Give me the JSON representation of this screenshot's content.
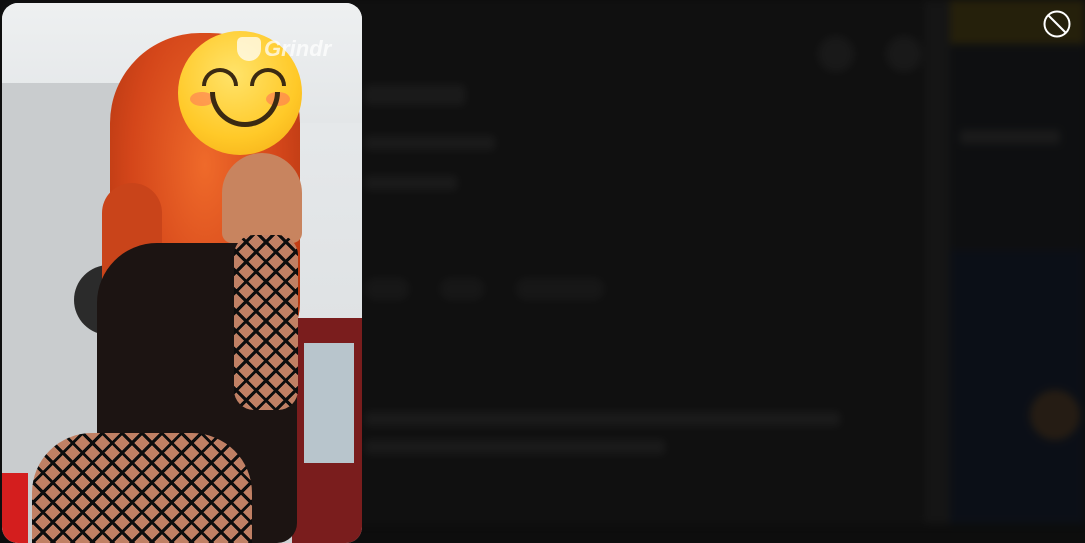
{
  "overlay": {
    "photo_watermark": "Grindr",
    "photo_overlay_emoji": "smiling-face-with-smiling-eyes",
    "block_icon": "prohibited-icon"
  },
  "colors": {
    "page_background": "#0d0d0d",
    "icon": "#ffffff"
  }
}
